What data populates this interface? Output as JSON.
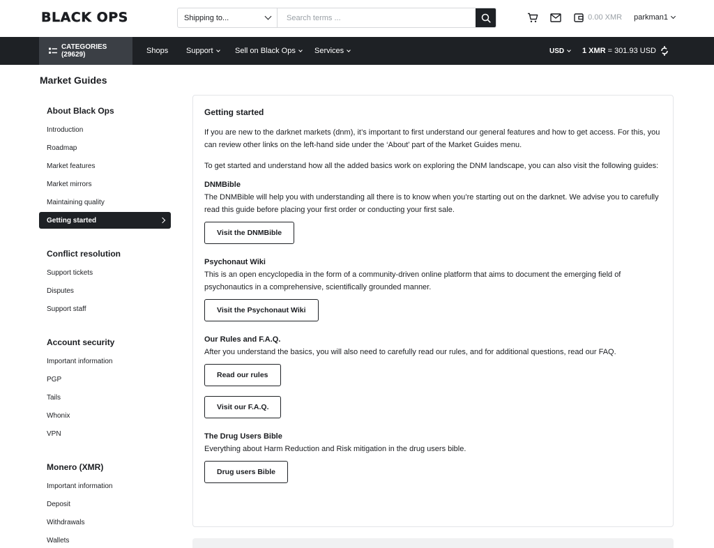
{
  "header": {
    "logo": "BLACK OPS",
    "ship_to": "Shipping to...",
    "search_placeholder": "Search terms ...",
    "balance": "0.00 XMR",
    "username": "parkman1"
  },
  "nav": {
    "categories": "CATEGORIES (29629)",
    "items": [
      {
        "label": "Shops",
        "dropdown": false
      },
      {
        "label": "Support",
        "dropdown": true
      },
      {
        "label": "Sell on Black Ops",
        "dropdown": true
      },
      {
        "label": "Services",
        "dropdown": true
      }
    ],
    "currency": "USD",
    "rate_prefix": "1 XMR",
    "rate_value": "= 301.93 USD"
  },
  "page": {
    "title": "Market Guides"
  },
  "sidebar": {
    "sections": [
      {
        "title": "About Black Ops",
        "items": [
          "Introduction",
          "Roadmap",
          "Market features",
          "Market mirrors",
          "Maintaining quality",
          "Getting started"
        ],
        "active": "Getting started"
      },
      {
        "title": "Conflict resolution",
        "items": [
          "Support tickets",
          "Disputes",
          "Support staff"
        ]
      },
      {
        "title": "Account security",
        "items": [
          "Important information",
          "PGP",
          "Tails",
          "Whonix",
          "VPN"
        ]
      },
      {
        "title": "Monero (XMR)",
        "items": [
          "Important information",
          "Deposit",
          "Withdrawals",
          "Wallets"
        ]
      }
    ]
  },
  "content": {
    "title": "Getting started",
    "intro1": "If you are new to the darknet markets (dnm), it’s important to first understand our general features and how to get access. For this, you can review other links on the left-hand side under the ‘About’ part of the Market Guides menu.",
    "intro2": "To get started and understand how all the added basics work on exploring the DNM landscape, you can also visit the following guides:",
    "guides": [
      {
        "title": "DNMBible",
        "text": "The DNMBible will help you with understanding all there is to know when you’re starting out on the darknet. We advise you to carefully read this guide before placing your first order or conducting your first sale.",
        "buttons": [
          "Visit the DNMBible"
        ]
      },
      {
        "title": "Psychonaut Wiki",
        "text": "This is an open encyclopedia in the form of a community-driven online platform that aims to document the emerging field of psychonautics in a comprehensive, scientifically grounded manner.",
        "buttons": [
          "Visit the Psychonaut Wiki"
        ]
      },
      {
        "title": "Our Rules and F.A.Q.",
        "text": "After you understand the basics, you will also need to carefully read our rules, and for additional questions, read our FAQ.",
        "buttons": [
          "Read our rules",
          "Visit our F.A.Q."
        ]
      },
      {
        "title": "The Drug Users Bible",
        "text": "Everything about Harm Reduction and Risk mitigation in the drug users bible.",
        "buttons": [
          "Drug users Bible"
        ]
      }
    ]
  },
  "icons": {
    "search": "search-icon",
    "cart": "cart-icon",
    "mail": "mail-icon",
    "wallet": "wallet-icon",
    "categories": "list-icon",
    "refresh": "exchange-rate-icon"
  },
  "colors": {
    "dark": "#1e2125",
    "category_bg": "#3b3f45",
    "border": "#e3e5e8",
    "muted": "#9aa0a6"
  }
}
